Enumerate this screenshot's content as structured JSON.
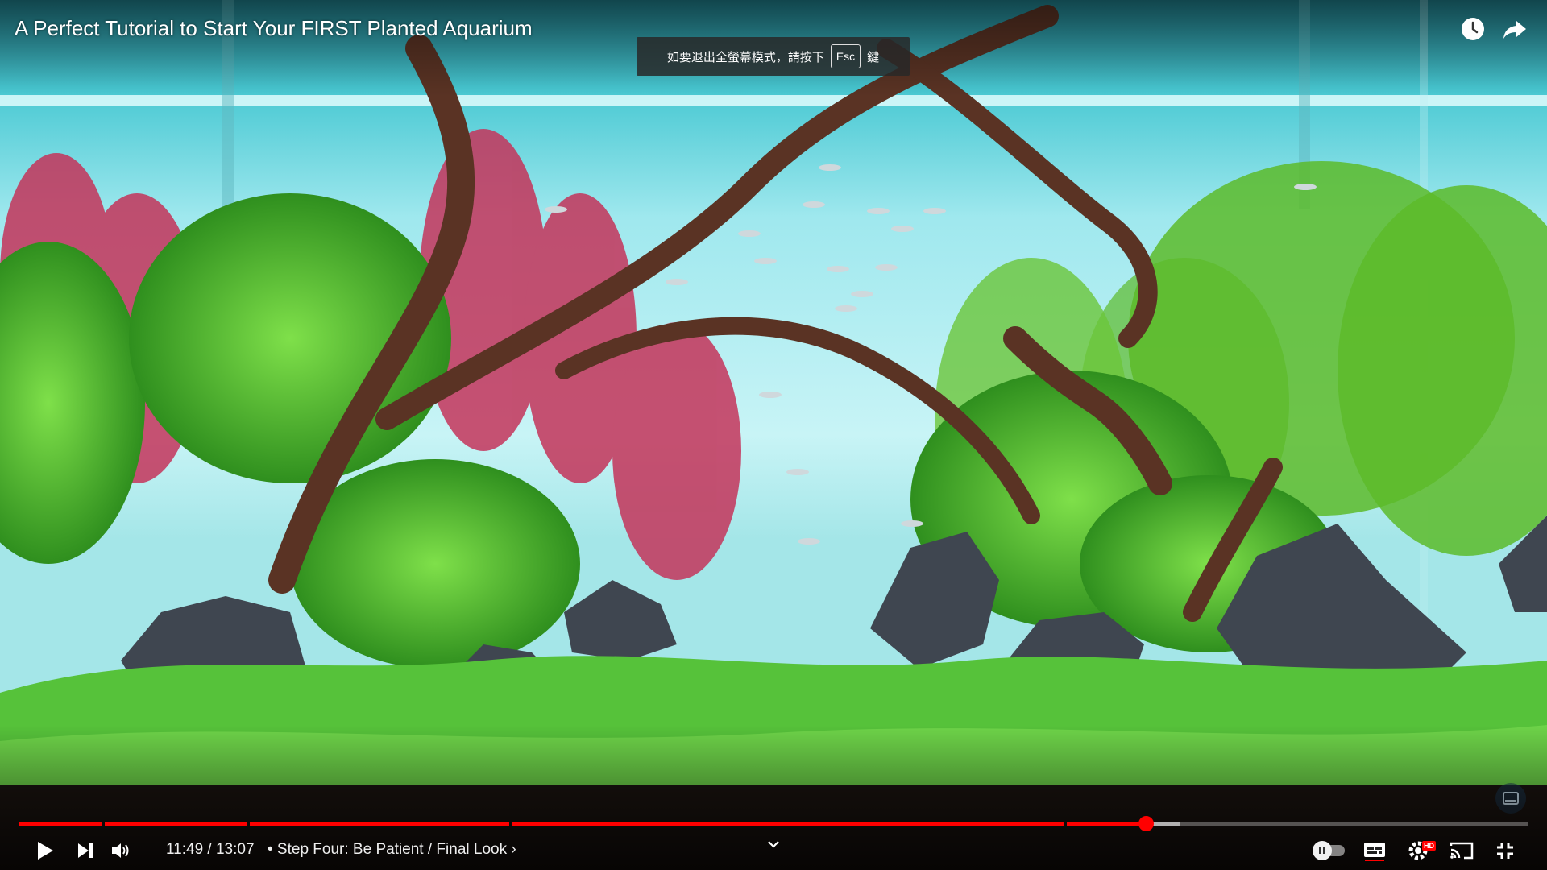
{
  "video": {
    "title": "A Perfect Tutorial to Start Your FIRST Planted Aquarium",
    "time_current": "11:49",
    "time_total": "13:07",
    "time_display": "11:49 / 13:07",
    "chapter_label": "• Step Four: Be Patient / Final Look",
    "chapter_arrow": "›",
    "progress_fraction": 0.9
  },
  "esc_hint": {
    "text_before": "如要退出全螢幕模式，請按下",
    "key": "Esc",
    "text_after": "鍵"
  },
  "icons": {
    "watch_later": "clock-icon",
    "share": "share-arrow-icon",
    "play": "play-icon",
    "next": "skip-next-icon",
    "volume": "volume-icon",
    "autoplay": "autoplay-toggle-icon",
    "subtitles": "subtitles-icon",
    "settings": "gear-icon",
    "cast": "cast-icon",
    "exit_fullscreen": "exit-fullscreen-icon",
    "expand": "chevron-up-icon"
  },
  "settings_badge": "HD",
  "colors": {
    "progress": "#ff0000",
    "text": "#ffffff"
  }
}
